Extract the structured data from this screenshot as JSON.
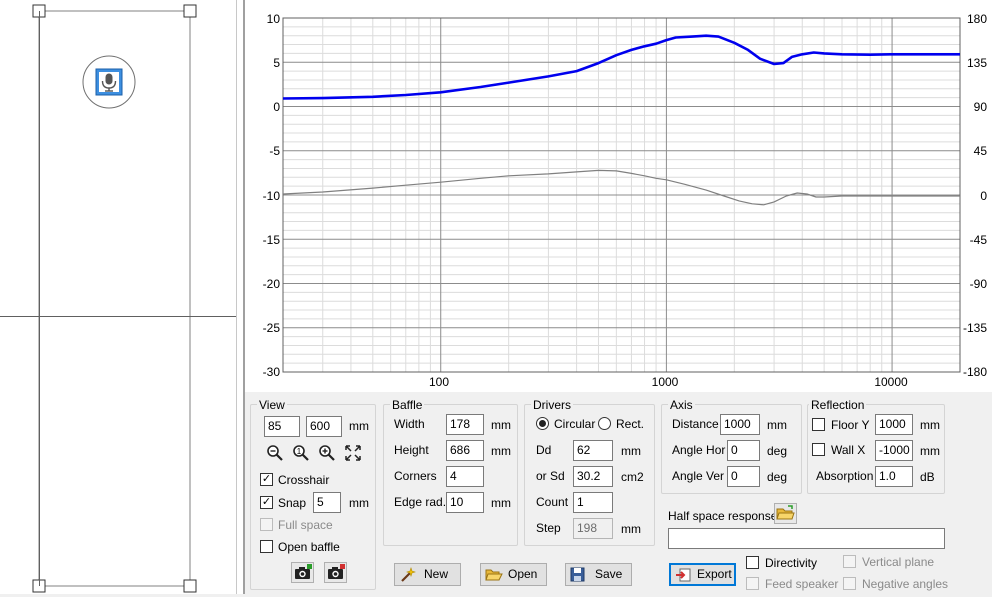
{
  "graph": {
    "y_left_ticks": [
      "10",
      "5",
      "0",
      "-5",
      "-10",
      "-15",
      "-20",
      "-25",
      "-30"
    ],
    "y_right_ticks": [
      "180",
      "135",
      "90",
      "45",
      "0",
      "-45",
      "-90",
      "-135",
      "-180"
    ],
    "x_ticks": [
      "100",
      "1000",
      "10000"
    ],
    "colors": {
      "magnitude": "#0000ee",
      "phase": "#808080",
      "grid_major": "#8c8c8c",
      "grid_minor": "#dcdcdc"
    }
  },
  "chart_data": {
    "type": "line",
    "x_scale": "log",
    "xlim": [
      20,
      20000
    ],
    "ylim": [
      -30,
      10
    ],
    "y2lim": [
      -180,
      180
    ],
    "series": [
      {
        "axis": "left",
        "x": [
          20,
          30,
          50,
          70,
          100,
          150,
          200,
          300,
          400,
          500,
          600,
          700,
          800,
          900,
          1000,
          1100,
          1300,
          1500,
          1700,
          2000,
          2300,
          2600,
          3000,
          3300,
          3600,
          4000,
          4500,
          5000,
          6000,
          8000,
          10000,
          15000,
          20000
        ],
        "y": [
          0.9,
          0.95,
          1.1,
          1.3,
          1.6,
          2.2,
          2.7,
          3.4,
          4.0,
          4.9,
          5.8,
          6.4,
          6.8,
          7.1,
          7.5,
          7.8,
          7.9,
          8.0,
          7.9,
          7.2,
          6.4,
          5.4,
          4.8,
          4.9,
          5.6,
          5.9,
          6.1,
          6.0,
          5.9,
          5.85,
          5.9,
          5.9,
          5.9
        ]
      },
      {
        "axis": "right",
        "x": [
          20,
          30,
          50,
          70,
          100,
          150,
          200,
          300,
          400,
          500,
          600,
          700,
          800,
          900,
          1000,
          1200,
          1500,
          1800,
          2100,
          2400,
          2700,
          3000,
          3400,
          3800,
          4200,
          4600,
          5000,
          6000,
          8000,
          10000,
          15000,
          20000
        ],
        "y": [
          1,
          3,
          7,
          10,
          13,
          17,
          19.5,
          21.5,
          23.5,
          25,
          24.5,
          22,
          19.5,
          17,
          15.5,
          11,
          5,
          -1,
          -6,
          -9,
          -10,
          -7,
          -1,
          2,
          1,
          -2,
          -2,
          -1,
          -1,
          -1,
          -1,
          -1
        ]
      }
    ]
  },
  "view": {
    "title": "View",
    "val1": "85",
    "val2": "600",
    "unit": "mm",
    "crosshair": "Crosshair",
    "snap": "Snap",
    "snap_val": "5",
    "snap_unit": "mm",
    "full_space": "Full space",
    "open_baffle": "Open baffle"
  },
  "baffle": {
    "title": "Baffle",
    "width_label": "Width",
    "width": "178",
    "height_label": "Height",
    "height": "686",
    "corners_label": "Corners",
    "corners": "4",
    "edge_label": "Edge rad.",
    "edge": "10",
    "unit": "mm"
  },
  "drivers": {
    "title": "Drivers",
    "circular": "Circular",
    "rect": "Rect.",
    "dd_label": "Dd",
    "dd": "62",
    "dd_unit": "mm",
    "sd_label": "or Sd",
    "sd": "30.2",
    "sd_unit": "cm2",
    "count_label": "Count",
    "count": "1",
    "step_label": "Step",
    "step": "198",
    "step_unit": "mm"
  },
  "axis": {
    "title": "Axis",
    "distance_label": "Distance",
    "distance": "1000",
    "distance_unit": "mm",
    "hor_label": "Angle Hor",
    "hor": "0",
    "hor_unit": "deg",
    "ver_label": "Angle Ver",
    "ver": "0",
    "ver_unit": "deg"
  },
  "reflection": {
    "title": "Reflection",
    "floor_label": "Floor Y",
    "floor": "1000",
    "floor_unit": "mm",
    "wall_label": "Wall  X",
    "wall": "-1000",
    "wall_unit": "mm",
    "absorption_label": "Absorption",
    "absorption": "1.0",
    "absorption_unit": "dB"
  },
  "half_space": {
    "label": "Half space response",
    "value": ""
  },
  "buttons": {
    "new": "New",
    "open": "Open",
    "save": "Save",
    "export": "Export"
  },
  "options": {
    "directivity": "Directivity",
    "vertical_plane": "Vertical plane",
    "feed_speaker": "Feed speaker",
    "negative_angles": "Negative angles"
  }
}
